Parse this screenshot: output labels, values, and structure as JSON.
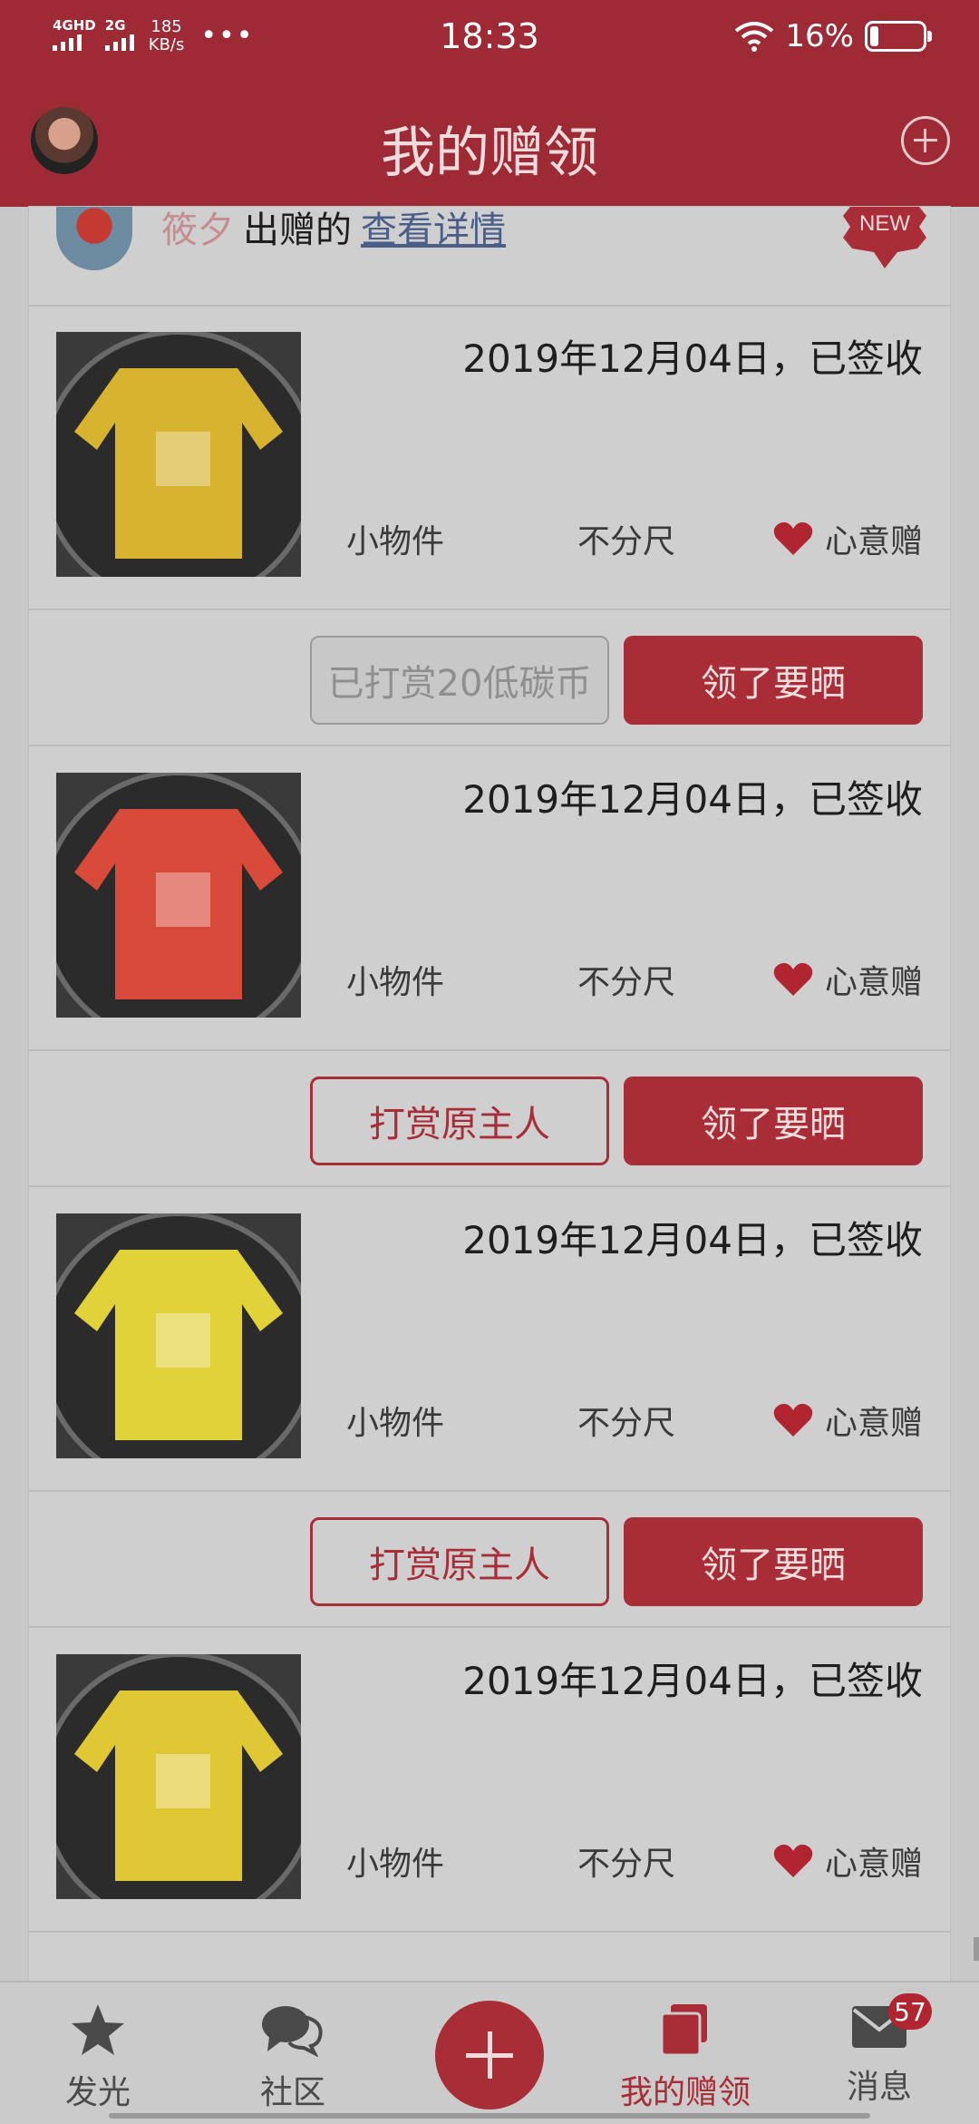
{
  "status_bar": {
    "network_1": "4GHD",
    "network_2": "2G",
    "speed_value": "185",
    "speed_unit": "KB/s",
    "dots": "•••",
    "time": "18:33",
    "battery_percent": "16%",
    "battery_level": 0.16
  },
  "header": {
    "title": "我的赠领"
  },
  "notice": {
    "name": "筱夕",
    "gave_text": "出赠的",
    "link_text": "查看详情",
    "badge": "NEW"
  },
  "items": [
    {
      "date_status": "2019年12月04日，已签收",
      "category": "小物件",
      "size": "不分尺",
      "gift_type": "心意赠",
      "secondary_button": "已打赏20低碳币",
      "secondary_disabled": true,
      "primary_button": "领了要晒",
      "photo_color": "#d8b330"
    },
    {
      "date_status": "2019年12月04日，已签收",
      "category": "小物件",
      "size": "不分尺",
      "gift_type": "心意赠",
      "secondary_button": "打赏原主人",
      "secondary_disabled": false,
      "primary_button": "领了要晒",
      "photo_color": "#d84a3a"
    },
    {
      "date_status": "2019年12月04日，已签收",
      "category": "小物件",
      "size": "不分尺",
      "gift_type": "心意赠",
      "secondary_button": "打赏原主人",
      "secondary_disabled": false,
      "primary_button": "领了要晒",
      "photo_color": "#e2d23a"
    },
    {
      "date_status": "2019年12月04日，已签收",
      "category": "小物件",
      "size": "不分尺",
      "gift_type": "心意赠",
      "secondary_button": "",
      "secondary_disabled": false,
      "primary_button": "",
      "photo_color": "#e0c834"
    }
  ],
  "tab_bar": {
    "tabs": [
      {
        "label": "发光",
        "icon": "star-icon"
      },
      {
        "label": "社区",
        "icon": "chat-icon"
      },
      {
        "label": "",
        "icon": "plus-icon"
      },
      {
        "label": "我的赠领",
        "icon": "stack-icon"
      },
      {
        "label": "消息",
        "icon": "mail-icon"
      }
    ],
    "message_badge": "57"
  },
  "colors": {
    "brand": "#a92d37",
    "header_bg": "#9d2a34"
  }
}
